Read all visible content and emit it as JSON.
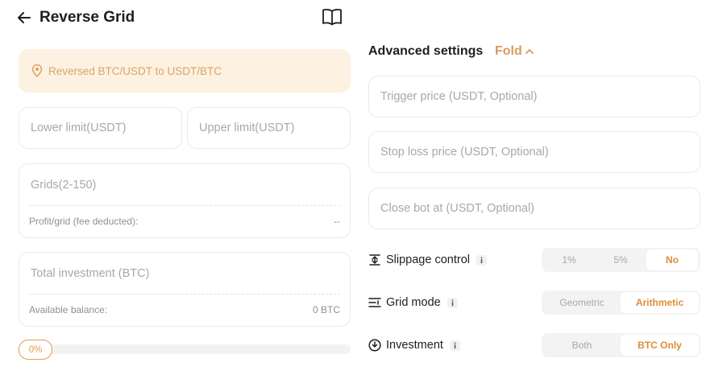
{
  "header": {
    "title": "Reverse Grid"
  },
  "notice": {
    "text": "Reversed BTC/USDT to USDT/BTC"
  },
  "form": {
    "lower_limit_placeholder": "Lower limit(USDT)",
    "upper_limit_placeholder": "Upper limit(USDT)",
    "grids_placeholder": "Grids(2-150)",
    "profit_label": "Profit/grid (fee deducted):",
    "profit_value": "--",
    "investment_placeholder": "Total investment (BTC)",
    "balance_label": "Available balance:",
    "balance_value": "0 BTC",
    "slider_value": "0%",
    "slider_fraction": 0
  },
  "advanced": {
    "title": "Advanced settings",
    "fold_label": "Fold",
    "trigger_placeholder": "Trigger price (USDT, Optional)",
    "stoploss_placeholder": "Stop loss price (USDT, Optional)",
    "closebot_placeholder": "Close bot at (USDT, Optional)",
    "slippage": {
      "label": "Slippage control",
      "options": [
        "1%",
        "5%",
        "No"
      ],
      "selected": "No"
    },
    "grid_mode": {
      "label": "Grid mode",
      "options": [
        "Geometric",
        "Arithmetic"
      ],
      "selected": "Arithmetic"
    },
    "investment": {
      "label": "Investment",
      "options": [
        "Both",
        "BTC Only"
      ],
      "selected": "BTC Only"
    }
  },
  "colors": {
    "accent": "#e08c3a",
    "notice_bg": "#fdf1e1",
    "notice_text": "#d9a566"
  },
  "icons": {
    "back": "arrow-left-icon",
    "book": "book-open-icon",
    "notice": "location-pin-icon",
    "fold": "chevron-up-icon",
    "slippage": "slippage-icon",
    "grid_mode": "grid-mode-icon",
    "investment": "download-circle-icon",
    "info": "info-icon"
  }
}
